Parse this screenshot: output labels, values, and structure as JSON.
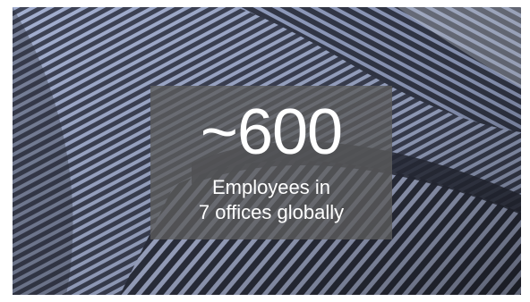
{
  "stat": {
    "number": "~600",
    "caption_line1": "Employees in",
    "caption_line2": "7 offices globally"
  },
  "colors": {
    "overlay": "#5c5c5c",
    "text": "#ffffff",
    "architecture_light": "#9aa6c8",
    "architecture_dark": "#2e3240"
  }
}
